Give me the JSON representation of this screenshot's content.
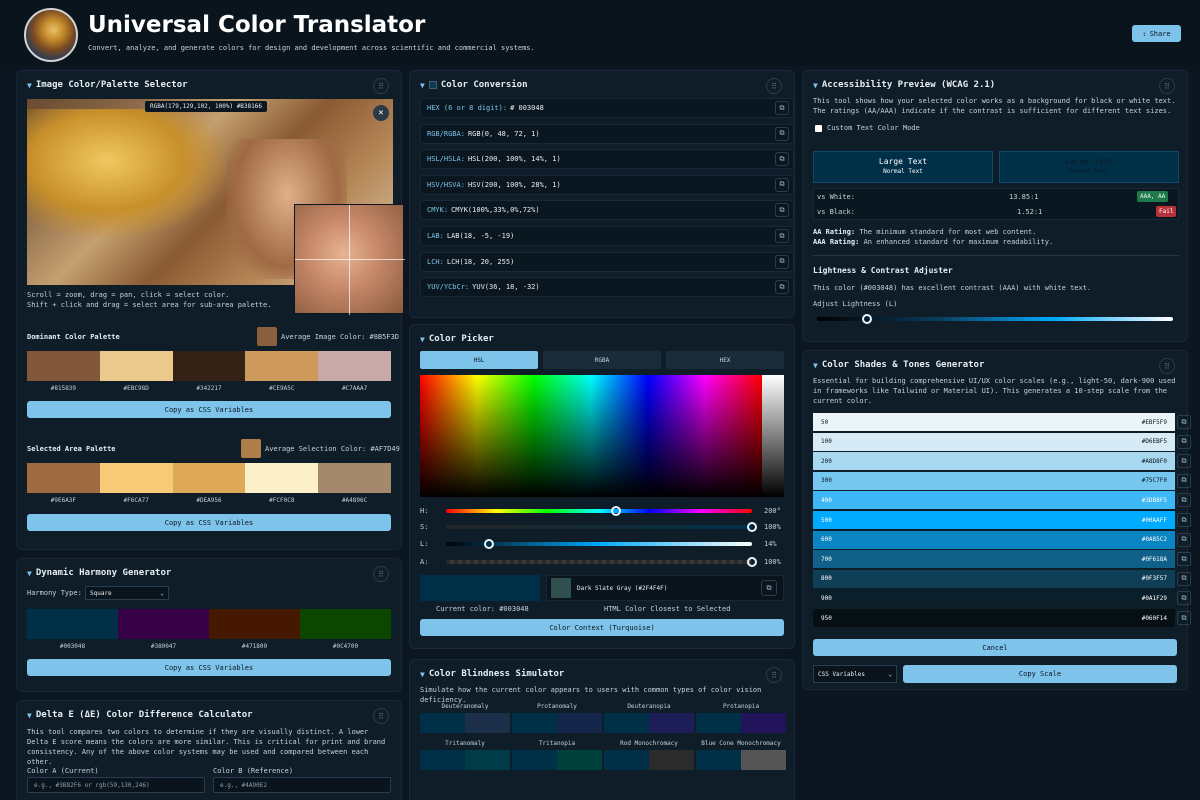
{
  "header": {
    "title": "Universal Color Translator",
    "subtitle": "Convert, analyze, and generate colors for design and development across scientific and commercial systems.",
    "share": "Share"
  },
  "image_panel": {
    "title": "Image Color/Palette Selector",
    "readout": "RGBA(179,129,102, 100%) #B38166",
    "help1": "Scroll = zoom, drag = pan, click = select color.",
    "help2": "Shift + click and drag = select area for sub-area palette.",
    "dominant_title": "Dominant Color Palette",
    "avg_image": "Average Image Color: #8B5F3D",
    "avg_image_color": "#8B5F3D",
    "dominant": [
      {
        "hex": "#815839",
        "color": "#815839"
      },
      {
        "hex": "#EBC98D",
        "color": "#EBC98D"
      },
      {
        "hex": "#342217",
        "color": "#342217"
      },
      {
        "hex": "#CE9A5C",
        "color": "#CE9A5C"
      },
      {
        "hex": "#C7AAA7",
        "color": "#C7AAA7"
      }
    ],
    "copy_css": "Copy as CSS Variables",
    "selected_title": "Selected Area Palette",
    "avg_sel": "Average Selection Color: #AF7D49",
    "avg_sel_color": "#AF7D49",
    "selected": [
      {
        "hex": "#9E6A3F",
        "color": "#9E6A3F"
      },
      {
        "hex": "#F6CA77",
        "color": "#F6CA77"
      },
      {
        "hex": "#DEA956",
        "color": "#DEA956"
      },
      {
        "hex": "#FCF0C8",
        "color": "#FCF0C8"
      },
      {
        "hex": "#A4896C",
        "color": "#A4896C"
      }
    ],
    "copy_css2": "Copy as CSS Variables"
  },
  "harmony": {
    "title": "Dynamic Harmony Generator",
    "type_label": "Harmony Type:",
    "type_value": "Square",
    "colors": [
      {
        "hex": "#003048",
        "color": "#003048"
      },
      {
        "hex": "#380047",
        "color": "#380047"
      },
      {
        "hex": "#471800",
        "color": "#471800"
      },
      {
        "hex": "#0C4700",
        "color": "#0C4700"
      }
    ],
    "copy": "Copy as CSS Variables"
  },
  "delta": {
    "title": "Delta E (ΔE) Color Difference Calculator",
    "desc": "This tool compares two colors to determine if they are visually distinct. A lower Delta E score means the colors are more similar. This is critical for print and brand consistency. Any of the above color systems may be used and compared between each other.",
    "a_label": "Color A (Current)",
    "a_placeholder": "e.g., #3B82F6 or rgb(59,130,246)",
    "b_label": "Color B (Reference)",
    "b_placeholder": "e.g., #4A90E2"
  },
  "conversion": {
    "title": "Color Conversion",
    "rows": [
      {
        "label": "HEX (6 or 8 digit):",
        "value": "# 003048"
      },
      {
        "label": "RGB/RGBA:",
        "value": "RGB(0, 48, 72, 1)"
      },
      {
        "label": "HSL/HSLA:",
        "value": "HSL(200, 100%, 14%, 1)"
      },
      {
        "label": "HSV/HSVA:",
        "value": "HSV(200, 100%, 28%, 1)"
      },
      {
        "label": "CMYK:",
        "value": "CMYK(100%,33%,0%,72%)"
      },
      {
        "label": "LAB:",
        "value": "LAB(18, -5, -19)"
      },
      {
        "label": "LCH:",
        "value": "LCH(18, 20, 255)"
      },
      {
        "label": "YUV/YCbCr:",
        "value": "YUV(36, 18, -32)"
      }
    ]
  },
  "picker": {
    "title": "Color Picker",
    "tabs": [
      "HSL",
      "RGBA",
      "HEX"
    ],
    "h_label": "H:",
    "h_value": "200°",
    "s_label": "S:",
    "s_value": "100%",
    "l_label": "L:",
    "l_value": "14%",
    "a_label": "A:",
    "a_value": "100%",
    "h_frac": 0.556,
    "s_frac": 1.0,
    "l_frac": 0.14,
    "a_frac": 1.0,
    "closest_name": "Dark Slate Gray (#2F4F4F)",
    "closest_color": "#2F4F4F",
    "current_color": "#003048",
    "current_text": "Current color: #003048",
    "closest_text": "HTML Color Closest to Selected",
    "context_btn": "Color Context (Turquoise)"
  },
  "blind": {
    "title": "Color Blindness Simulator",
    "desc": "Simulate how the current color appears to users with common types of color vision deficiency.",
    "types": [
      {
        "name": "Deuteranomaly",
        "a": "#003048",
        "b": "#1c2f48"
      },
      {
        "name": "Protanomaly",
        "a": "#003048",
        "b": "#14264a"
      },
      {
        "name": "Deuteranopia",
        "a": "#003048",
        "b": "#1d1d58"
      },
      {
        "name": "Protanopia",
        "a": "#003048",
        "b": "#21145a"
      },
      {
        "name": "Tritanomaly",
        "a": "#003048",
        "b": "#003c48"
      },
      {
        "name": "Tritanopia",
        "a": "#003048",
        "b": "#00403a"
      },
      {
        "name": "Rod Monochromacy",
        "a": "#003048",
        "b": "#2b2b2b"
      },
      {
        "name": "Blue Cone Monochromacy",
        "a": "#003048",
        "b": "#555555"
      }
    ]
  },
  "access": {
    "title": "Accessibility Preview (WCAG 2.1)",
    "desc": "This tool shows how your selected color works as a background for black or white text. The ratings (AA/AAA) indicate if the contrast is sufficient for different text sizes.",
    "custom_label": "Custom Text Color Mode",
    "large_text": "Large Text",
    "normal_text": "Normal Text",
    "vs_white": "vs White:",
    "white_ratio": "13.85:1",
    "white_badge": "AAA, AA",
    "vs_black": "vs Black:",
    "black_ratio": "1.52:1",
    "black_badge": "Fail",
    "aa_label": "AA Rating:",
    "aa_text": "The minimum standard for most web content.",
    "aaa_label": "AAA Rating:",
    "aaa_text": "An enhanced standard for maximum readability.",
    "adjuster_title": "Lightness & Contrast Adjuster",
    "adjuster_text": "This color (#003048) has excellent contrast (AAA) with white text.",
    "adjust_label": "Adjust Lightness (L)",
    "lightness_frac": 0.14
  },
  "shades": {
    "title": "Color Shades & Tones Generator",
    "desc": "Essential for building comprehensive UI/UX color scales (e.g., light-50, dark-900 used in frameworks like Tailwind or Material UI). This generates a 10-step scale from the current color.",
    "items": [
      {
        "step": "50",
        "hex": "#EBF5F9",
        "bg": "#EBF5F9",
        "fg": "#0b1620"
      },
      {
        "step": "100",
        "hex": "#D6EBF5",
        "bg": "#D6EBF5",
        "fg": "#0b1620"
      },
      {
        "step": "200",
        "hex": "#A8D8F0",
        "bg": "#A8D8F0",
        "fg": "#0b1620"
      },
      {
        "step": "300",
        "hex": "#75C7F0",
        "bg": "#75C7F0",
        "fg": "#0b1620"
      },
      {
        "step": "400",
        "hex": "#3DB8F5",
        "bg": "#3DB8F5",
        "fg": "#ffffff"
      },
      {
        "step": "500",
        "hex": "#00AAFF",
        "bg": "#00AAFF",
        "fg": "#ffffff"
      },
      {
        "step": "600",
        "hex": "#0A85C2",
        "bg": "#0A85C2",
        "fg": "#ffffff"
      },
      {
        "step": "700",
        "hex": "#0F618A",
        "bg": "#0F618A",
        "fg": "#ffffff"
      },
      {
        "step": "800",
        "hex": "#0F3F57",
        "bg": "#0F3F57",
        "fg": "#ffffff"
      },
      {
        "step": "900",
        "hex": "#0A1F29",
        "bg": "#0A1F29",
        "fg": "#ffffff"
      },
      {
        "step": "950",
        "hex": "#060F14",
        "bg": "#060F14",
        "fg": "#ffffff"
      }
    ],
    "cancel": "Cancel",
    "format": "CSS Variables",
    "copy_scale": "Copy Scale"
  }
}
